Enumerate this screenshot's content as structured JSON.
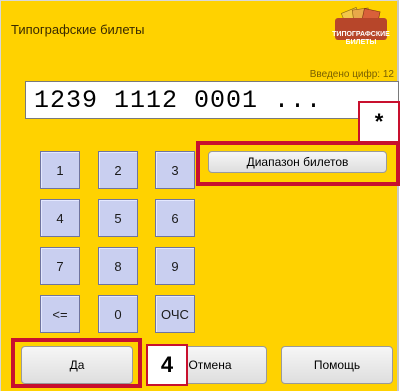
{
  "window": {
    "title": "Типографские билеты"
  },
  "logo": {
    "line1": "ТИПОГРАФСКИЕ",
    "line2": "БИЛЕТЫ"
  },
  "entry": {
    "digits_label": "Введено цифр: 12",
    "value": "1239 1112 0001 ..."
  },
  "keypad": {
    "keys": [
      "1",
      "2",
      "3",
      "4",
      "5",
      "6",
      "7",
      "8",
      "9",
      "<=",
      "0",
      "ОЧС"
    ]
  },
  "buttons": {
    "range": "Диапазон билетов",
    "ok": "Да",
    "cancel": "Отмена",
    "help": "Помощь"
  },
  "annotations": {
    "star": "*",
    "four": "4",
    "highlight_color": "#c8102e"
  }
}
